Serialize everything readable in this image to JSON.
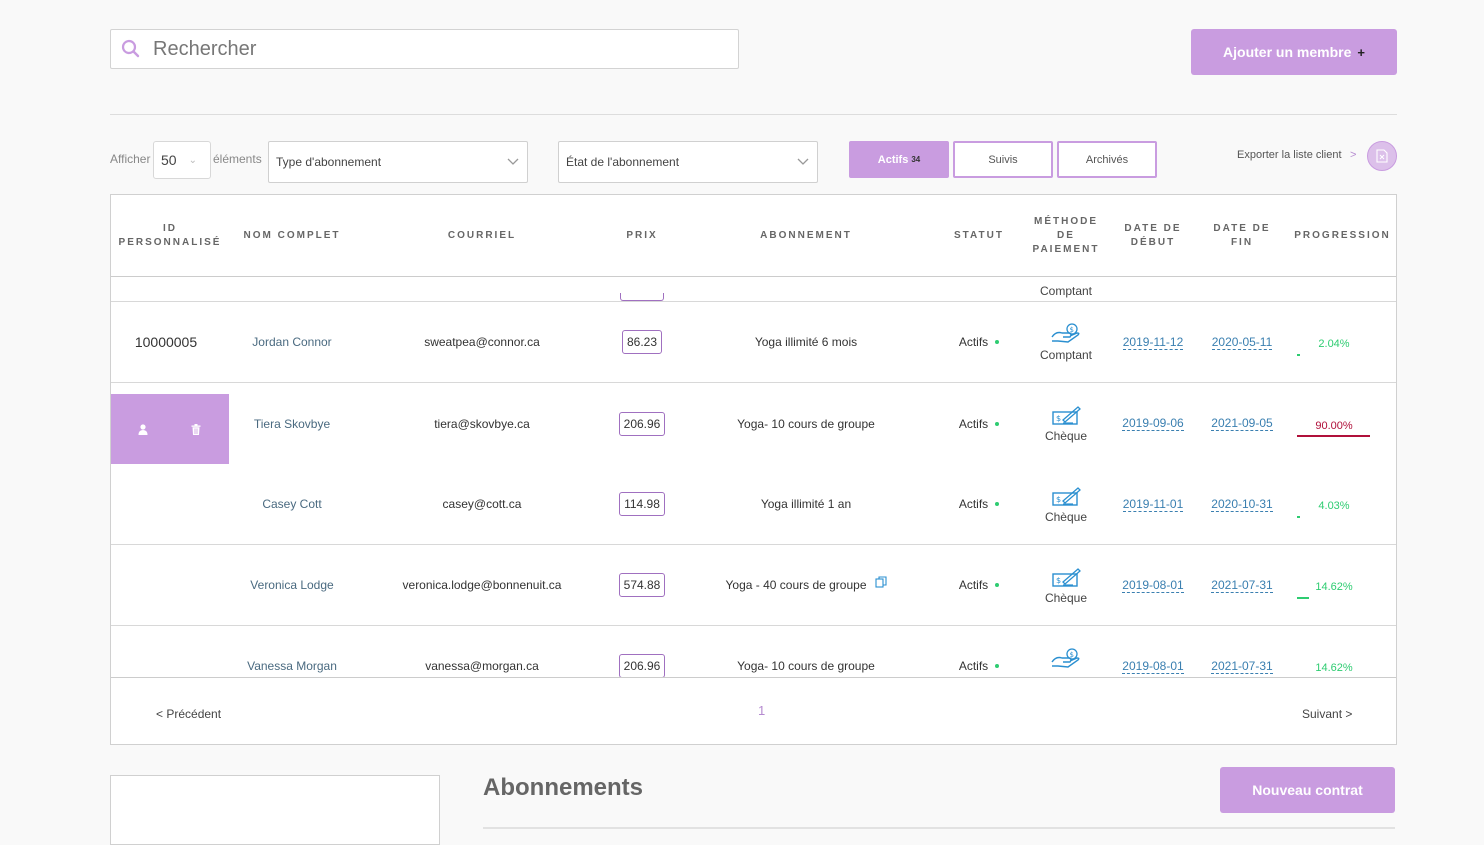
{
  "search": {
    "placeholder": "Rechercher"
  },
  "add_member": {
    "label": "Ajouter un membre",
    "plus": "+"
  },
  "filters": {
    "show_label": "Afficher",
    "count_value": "50",
    "items_label": "éléments",
    "type_placeholder": "Type d'abonnement",
    "state_placeholder": "État de l'abonnement"
  },
  "tabs": [
    {
      "label": "Actifs",
      "count": "34",
      "active": true
    },
    {
      "label": "Suivis",
      "active": false
    },
    {
      "label": "Archivés",
      "active": false
    }
  ],
  "export": {
    "label": "Exporter la liste client",
    "chevron": ">"
  },
  "table": {
    "headers": {
      "id_line1": "ID",
      "id_line2": "PERSONNALISÉ",
      "name": "NOM COMPLET",
      "email": "COURRIEL",
      "price": "PRIX",
      "subscription": "ABONNEMENT",
      "status": "STATUT",
      "pay_line1": "MÉTHODE",
      "pay_line2": "DE",
      "pay_line3": "PAIEMENT",
      "start_line1": "DATE DE",
      "start_line2": "DÉBUT",
      "end_line1": "DATE DE",
      "end_line2": "FIN",
      "progress": "PROGRESSION"
    },
    "partial_row": {
      "payment": "Comptant"
    },
    "rows": [
      {
        "id": "10000005",
        "name": "Jordan Connor",
        "email": "sweatpea@connor.ca",
        "price": "86.23",
        "subscription": "Yoga illimité 6 mois",
        "status": "Actifs",
        "payment": "Comptant",
        "start": "2019-11-12",
        "end": "2020-05-11",
        "progress": "2.04%",
        "progress_fraction": 0.0204
      },
      {
        "id": "",
        "name": "Tiera Skovbye",
        "email": "tiera@skovbye.ca",
        "price": "206.96",
        "subscription": "Yoga- 10 cours de groupe",
        "status": "Actifs",
        "payment": "Chèque",
        "start": "2019-09-06",
        "end": "2021-09-05",
        "progress": "90.00%",
        "progress_fraction": 0.9
      },
      {
        "id": "",
        "name": "Casey Cott",
        "email": "casey@cott.ca",
        "price": "114.98",
        "subscription": "Yoga illimité 1 an",
        "status": "Actifs",
        "payment": "Chèque",
        "start": "2019-11-01",
        "end": "2020-10-31",
        "progress": "4.03%",
        "progress_fraction": 0.0403
      },
      {
        "id": "",
        "name": "Veronica Lodge",
        "email": "veronica.lodge@bonnenuit.ca",
        "price": "574.88",
        "subscription": "Yoga - 40 cours de groupe",
        "status": "Actifs",
        "payment": "Chèque",
        "start": "2019-08-01",
        "end": "2021-07-31",
        "progress": "14.62%",
        "progress_fraction": 0.1462
      },
      {
        "id": "",
        "name": "Vanessa Morgan",
        "email": "vanessa@morgan.ca",
        "price": "206.96",
        "subscription": "Yoga- 10 cours de groupe",
        "status": "Actifs",
        "payment": "",
        "start": "2019-08-01",
        "end": "2021-07-31",
        "progress": "14.62%",
        "progress_fraction": 0.1462
      }
    ]
  },
  "pagination": {
    "prev": "< Précédent",
    "page": "1",
    "next": "Suivant >"
  },
  "subscriptions_section": {
    "title": "Abonnements",
    "new_contract": "Nouveau contrat"
  },
  "colors": {
    "accent": "#c99ce0",
    "progress_high": "#b0103a",
    "progress_low": "#2ecc71",
    "link": "#3a7fb0"
  }
}
